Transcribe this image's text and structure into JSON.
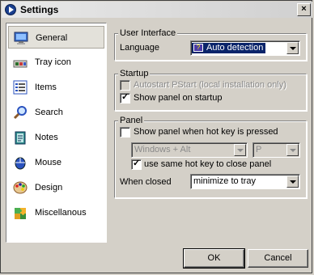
{
  "window": {
    "title": "Settings",
    "close_glyph": "×"
  },
  "sidebar": {
    "items": [
      {
        "label": "General",
        "icon": "monitor-icon",
        "selected": true
      },
      {
        "label": "Tray icon",
        "icon": "tray-icon"
      },
      {
        "label": "Items",
        "icon": "list-icon"
      },
      {
        "label": "Search",
        "icon": "magnifier-icon"
      },
      {
        "label": "Notes",
        "icon": "notes-icon"
      },
      {
        "label": "Mouse",
        "icon": "mouse-icon"
      },
      {
        "label": "Design",
        "icon": "palette-icon"
      },
      {
        "label": "Miscellanous",
        "icon": "puzzle-icon"
      }
    ]
  },
  "user_interface": {
    "title": "User Interface",
    "language_label": "Language",
    "language_value": "Auto detection"
  },
  "startup": {
    "title": "Startup",
    "autostart_label": "Autostart PStart (local installation only)",
    "show_panel_label": "Show panel on startup"
  },
  "panel": {
    "title": "Panel",
    "hotkey_label": "Show panel when hot key is pressed",
    "hotkey_modifier": "Windows + Alt",
    "hotkey_key": "P",
    "same_hotkey_label": "use same hot key to close panel",
    "when_closed_label": "When closed",
    "when_closed_value": "minimize to tray"
  },
  "buttons": {
    "ok": "OK",
    "cancel": "Cancel"
  },
  "colors": {
    "face": "#d4d0c8",
    "selection": "#0a246a"
  }
}
